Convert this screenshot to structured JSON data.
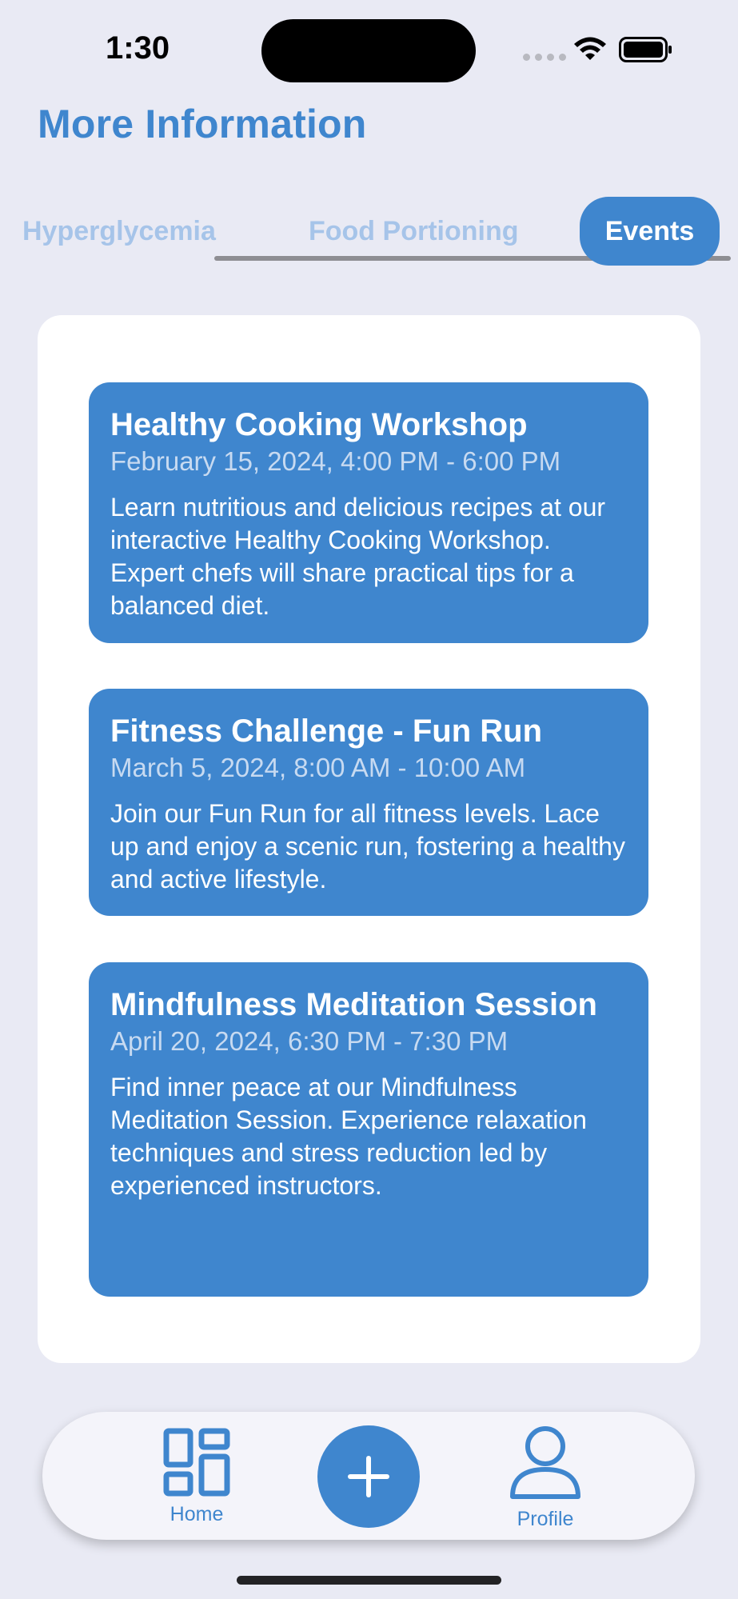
{
  "status_bar": {
    "time": "1:30",
    "icons": [
      "signal-icon",
      "wifi-icon",
      "battery-icon"
    ]
  },
  "page": {
    "title": "More Information"
  },
  "tabs": [
    {
      "label": "Hyperglycemia",
      "selected": false
    },
    {
      "label": "Food Portioning",
      "selected": false
    },
    {
      "label": "Events",
      "selected": true
    }
  ],
  "events": [
    {
      "title": "Healthy Cooking Workshop",
      "date": "February 15, 2024, 4:00 PM - 6:00 PM",
      "description": "Learn nutritious and delicious recipes at our interactive Healthy Cooking Workshop. Expert chefs will share practical tips for a balanced diet."
    },
    {
      "title": "Fitness Challenge - Fun Run",
      "date": "March 5, 2024, 8:00 AM - 10:00 AM",
      "description": "Join our Fun Run for all fitness levels. Lace up and enjoy a scenic run, fostering a healthy and active lifestyle."
    },
    {
      "title": "Mindfulness Meditation Session",
      "date": "April 20, 2024, 6:30 PM - 7:30 PM",
      "description": "Find inner peace at our Mindfulness Meditation Session. Experience relaxation techniques and stress reduction led by experienced instructors."
    }
  ],
  "nav": {
    "home_label": "Home",
    "add_icon": "plus-icon",
    "profile_label": "Profile"
  },
  "colors": {
    "accent": "#3F86CE",
    "background": "#E9EAF4",
    "tab_inactive": "#A6C4E9"
  }
}
